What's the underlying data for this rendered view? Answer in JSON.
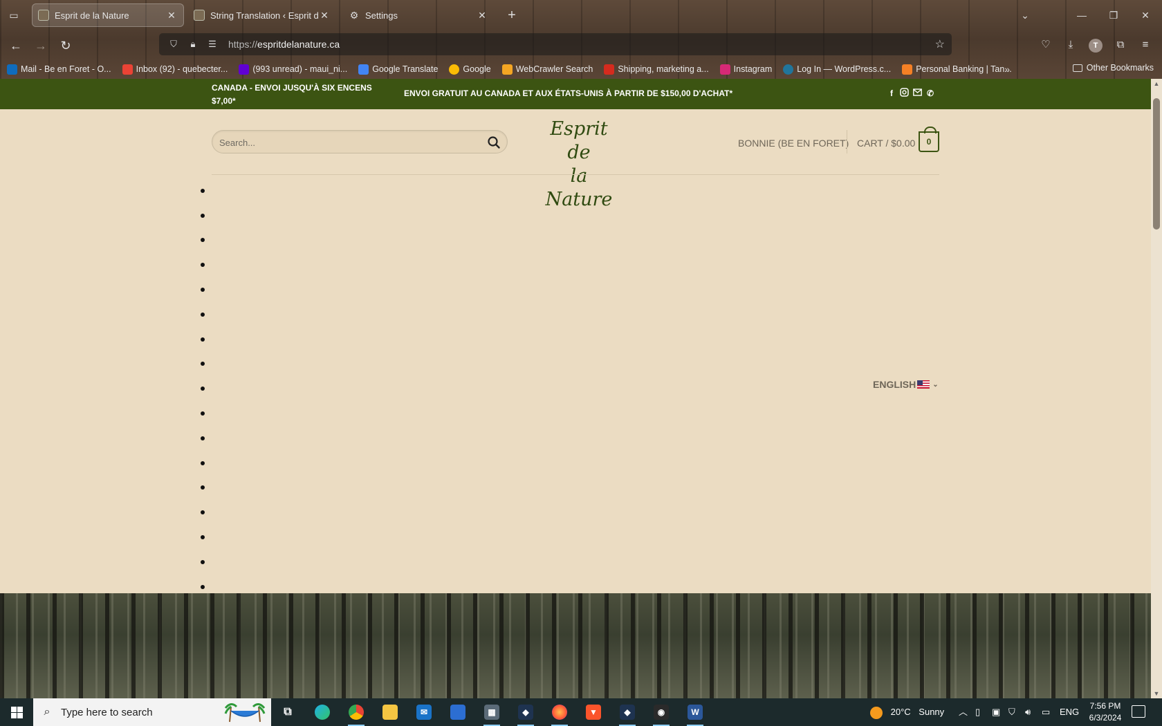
{
  "browser": {
    "tabs": [
      {
        "title": "Esprit de la Nature",
        "active": true
      },
      {
        "title": "String Translation ‹ Esprit de la N",
        "active": false
      },
      {
        "title": "Settings",
        "active": false
      }
    ],
    "url_protocol": "https://",
    "url_host": "espritdelanature.ca",
    "profile_initial": "T",
    "bookmarks": [
      {
        "label": "Mail - Be en Foret - O...",
        "color": "#0f6cbd"
      },
      {
        "label": "Inbox (92) - quebecter...",
        "color": "#ea4335"
      },
      {
        "label": "(993 unread) - maui_ni...",
        "color": "#6001d2"
      },
      {
        "label": "Google Translate",
        "color": "#4285f4"
      },
      {
        "label": "Google",
        "color": "#fbbc05"
      },
      {
        "label": "WebCrawler Search",
        "color": "#f4a623"
      },
      {
        "label": "Shipping, marketing a...",
        "color": "#d52b1e"
      },
      {
        "label": "Instagram",
        "color": "#d62976"
      },
      {
        "label": "Log In — WordPress.c...",
        "color": "#21759b"
      },
      {
        "label": "Personal Banking | Tan...",
        "color": "#f58025"
      }
    ],
    "other_bookmarks": "Other Bookmarks"
  },
  "site": {
    "promo_left": "CANADA - ENVOI JUSQU'À SIX ENCENS $7,00*",
    "promo_center": "ENVOI GRATUIT AU CANADA ET AUX ÉTATS-UNIS À PARTIR DE $150,00 D'ACHAT*",
    "social_icons": [
      "facebook-icon",
      "instagram-icon",
      "email-icon",
      "phone-icon"
    ],
    "search_placeholder": "Search...",
    "logo_line1": "Esprit de",
    "logo_line2": "la Nature",
    "account_label": "BONNIE (BE EN FORET)",
    "cart_label": "CART / $0.00",
    "cart_count": "0",
    "bullet_count": 17,
    "language_label": "ENGLISH",
    "brand_green": "#3c5412",
    "page_bg": "#ebdcc2"
  },
  "taskbar": {
    "search_placeholder": "Type here to search",
    "apps": [
      "task-view",
      "edge",
      "chrome",
      "file-explorer",
      "mail",
      "store",
      "calculator",
      "app-dark-1",
      "firefox",
      "brave",
      "app-dark-2",
      "app-eye",
      "word"
    ],
    "weather_temp": "20°C",
    "weather_desc": "Sunny",
    "language": "ENG",
    "time": "7:56 PM",
    "date": "6/3/2024"
  }
}
